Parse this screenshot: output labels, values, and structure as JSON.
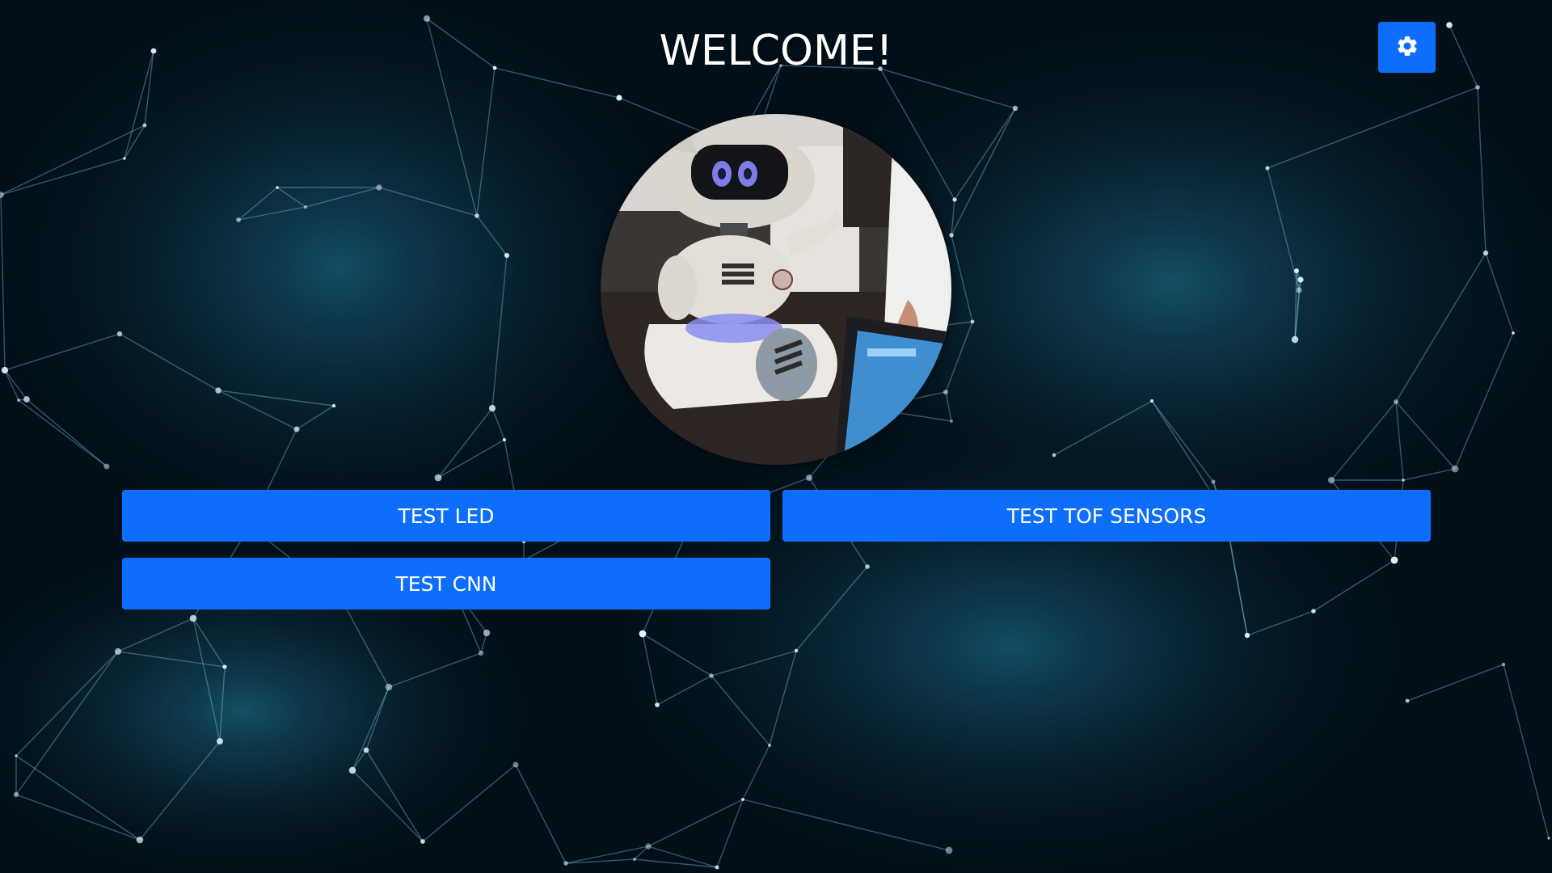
{
  "header": {
    "title": "WELCOME!"
  },
  "settings": {
    "icon": "gear-icon"
  },
  "avatar": {
    "subject": "robot-photo"
  },
  "actions": [
    {
      "label": "TEST LED"
    },
    {
      "label": "TEST TOF SENSORS"
    },
    {
      "label": "TEST CNN"
    }
  ],
  "colors": {
    "button": "#0d6efd",
    "background": "#04111a",
    "network_line": "#7fd3ea"
  }
}
